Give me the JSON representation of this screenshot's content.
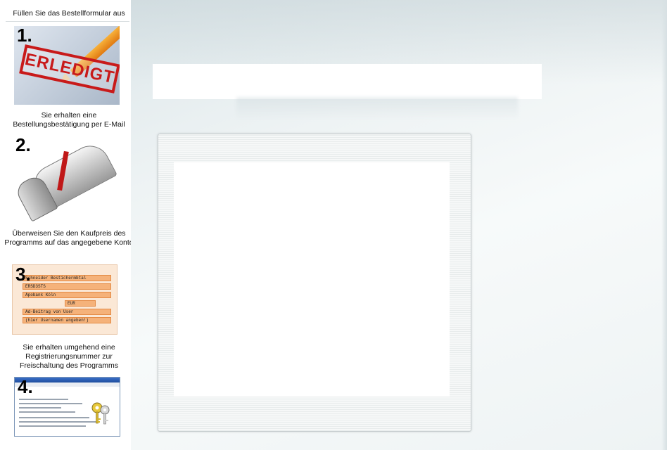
{
  "sidebar": {
    "heading": "Füllen Sie das Bestellformular  aus",
    "steps": [
      {
        "number": "1.",
        "image": "erledigt-stamp-image",
        "stamp_text": "ERLEDIGT",
        "caption": "Sie erhalten eine Bestellungsbestätigung per E-Mail"
      },
      {
        "number": "2.",
        "image": "mailbox-image",
        "caption": "Überweisen Sie den Kaufpreis des Programms auf das angegebene Konto"
      },
      {
        "number": "3.",
        "image": "bank-transfer-form-image",
        "caption": "Sie erhalten umgehend eine Registrierungsnummer zur Freischaltung des Programms"
      },
      {
        "number": "4.",
        "image": "registration-window-keys-image"
      }
    ],
    "form_lines": [
      "Schneider Bestichermbtal",
      "ERSD3STS",
      "Apobank Köln",
      "EUR",
      "Ad-Beitrag von User",
      "(hier Usernamen angeben!)"
    ]
  },
  "colors": {
    "stamp_red": "#c81a1a",
    "form_orange": "#f5b27a",
    "window_blue": "#2a5fb8"
  }
}
